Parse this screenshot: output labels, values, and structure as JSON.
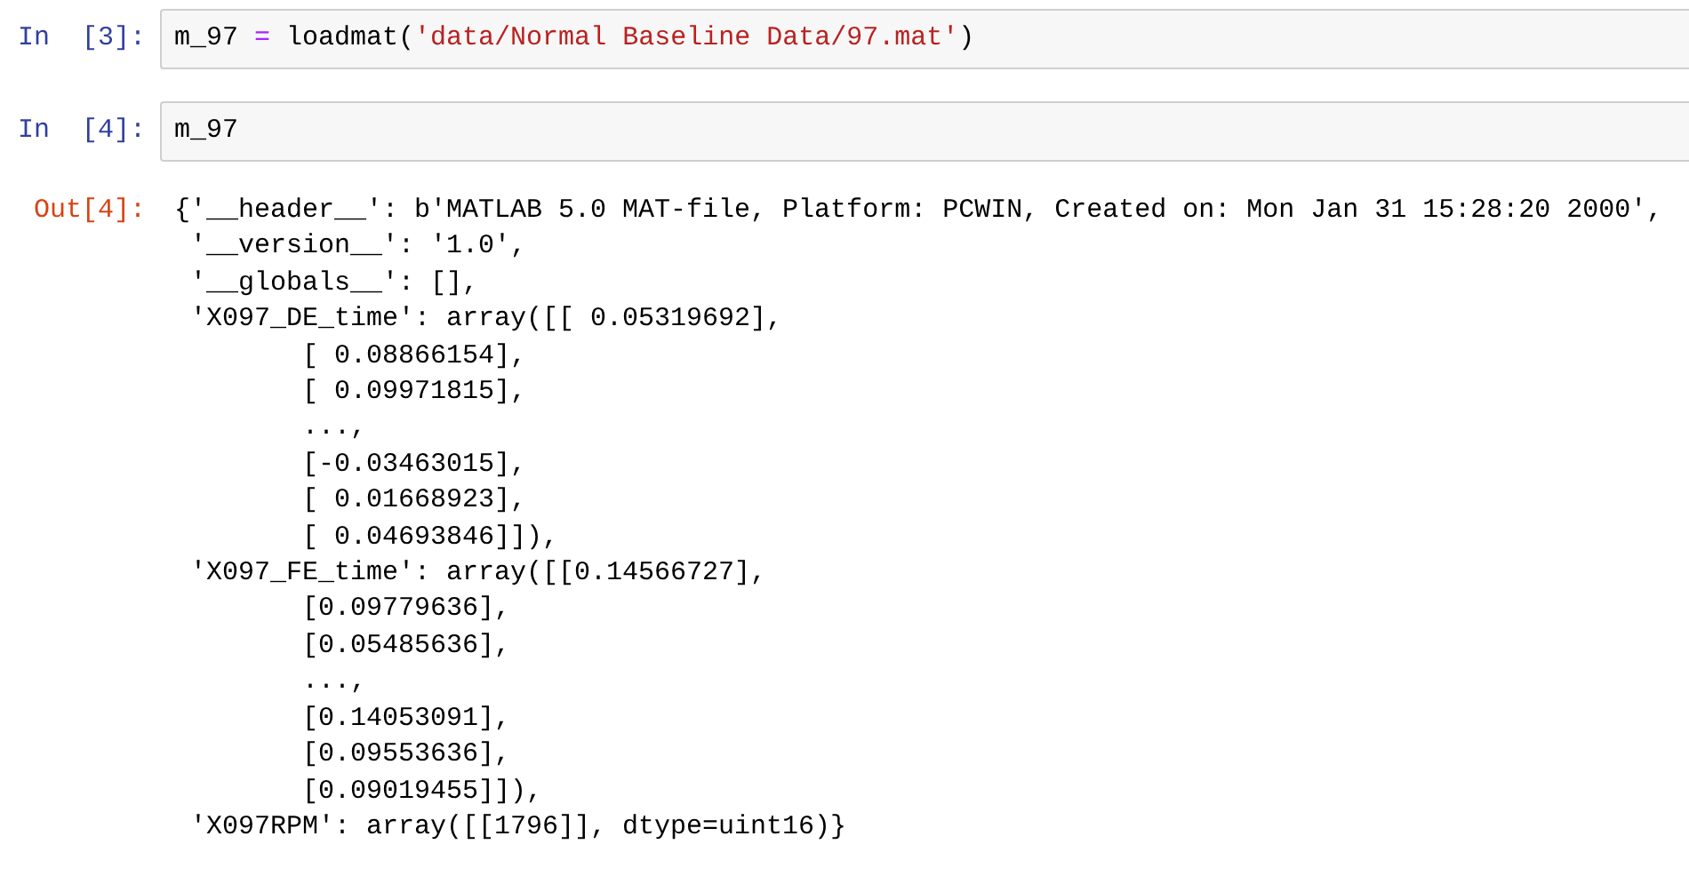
{
  "cells": [
    {
      "kind": "input",
      "prompt": "In  [3]:",
      "code": [
        {
          "kind": "name",
          "text": "m_97 "
        },
        {
          "kind": "operator",
          "text": "="
        },
        {
          "kind": "name",
          "text": " loadmat("
        },
        {
          "kind": "string",
          "text": "'data/Normal Baseline Data/97.mat'"
        },
        {
          "kind": "name",
          "text": ")"
        }
      ]
    },
    {
      "kind": "input",
      "prompt": "In  [4]:",
      "code": [
        {
          "kind": "name",
          "text": "m_97"
        }
      ]
    },
    {
      "kind": "output",
      "prompt": "Out[4]:",
      "lines": [
        "{'__header__': b'MATLAB 5.0 MAT-file, Platform: PCWIN, Created on: Mon Jan 31 15:28:20 2000',",
        " '__version__': '1.0',",
        " '__globals__': [],",
        " 'X097_DE_time': array([[ 0.05319692],",
        "        [ 0.08866154],",
        "        [ 0.09971815],",
        "        ...,",
        "        [-0.03463015],",
        "        [ 0.01668923],",
        "        [ 0.04693846]]),",
        " 'X097_FE_time': array([[0.14566727],",
        "        [0.09779636],",
        "        [0.05485636],",
        "        ...,",
        "        [0.14053091],",
        "        [0.09553636],",
        "        [0.09019455]]),",
        " 'X097RPM': array([[1796]], dtype=uint16)}"
      ]
    }
  ]
}
